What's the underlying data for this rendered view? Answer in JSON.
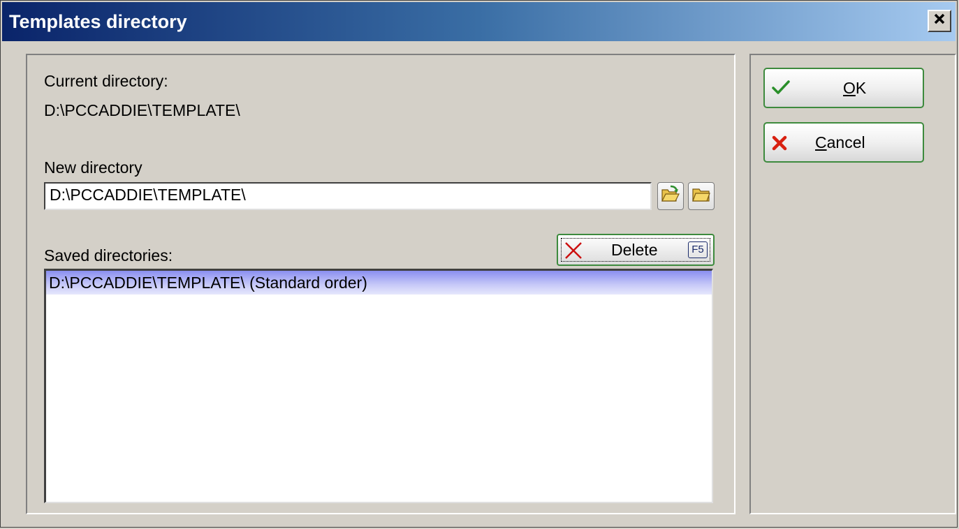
{
  "window": {
    "title": "Templates directory",
    "close_label": "x"
  },
  "current_directory": {
    "label": "Current directory:",
    "value": "D:\\PCCADDIE\\TEMPLATE\\"
  },
  "new_directory": {
    "label": "New directory",
    "value": "D:\\PCCADDIE\\TEMPLATE\\"
  },
  "saved_directories": {
    "label": "Saved directories:",
    "items": [
      "D:\\PCCADDIE\\TEMPLATE\\ (Standard order)"
    ],
    "selected_index": 0
  },
  "delete_button": {
    "label": "Delete",
    "shortcut": "F5"
  },
  "ok_button": {
    "mnemonic": "O",
    "rest": "K"
  },
  "cancel_button": {
    "mnemonic": "C",
    "rest": "ancel"
  },
  "icons": {
    "ok": "check-icon",
    "cancel": "x-icon",
    "delete": "x-icon",
    "open_folder": "folder-open-icon",
    "browse_folder": "folder-icon"
  },
  "colors": {
    "title_start": "#0a246a",
    "title_end": "#a6caf0",
    "button_border": "#3d8a3d",
    "selection": "#8a8ff0"
  }
}
